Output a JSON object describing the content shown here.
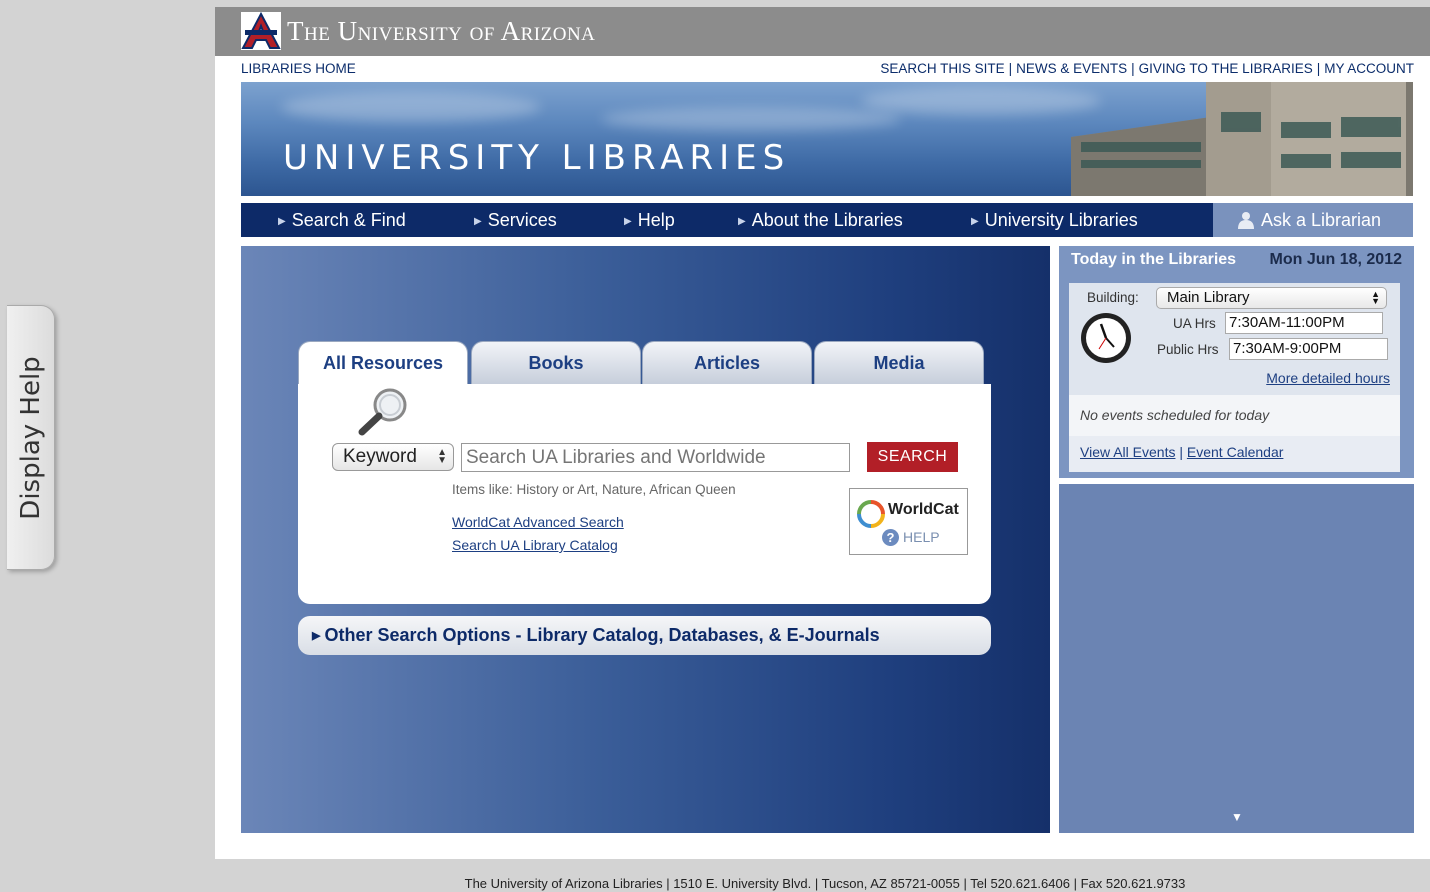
{
  "help_tab": {
    "label": "Display Help"
  },
  "header": {
    "university_name": "The University of Arizona",
    "libraries_home": "LIBRARIES HOME",
    "util_links": [
      "SEARCH THIS SITE",
      "NEWS & EVENTS",
      "GIVING TO THE LIBRARIES",
      "MY ACCOUNT"
    ],
    "banner_title": "UNIVERSITY LIBRARIES"
  },
  "nav": {
    "items": [
      "Search & Find",
      "Services",
      "Help",
      "About the Libraries",
      "University Libraries"
    ],
    "ask_label": "Ask a Librarian"
  },
  "search": {
    "tabs": [
      "All Resources",
      "Books",
      "Articles",
      "Media"
    ],
    "active_tab": "All Resources",
    "type_select": "Keyword",
    "input_placeholder": "Search UA Libraries and Worldwide",
    "button_label": "SEARCH",
    "hint": "Items like: History or Art, Nature, African Queen",
    "links": [
      "WorldCat Advanced Search",
      "Search UA Library Catalog"
    ],
    "worldcat_name": "WorldCat",
    "worldcat_help": "HELP",
    "other_options": "Other Search Options - Library Catalog, Databases, & E-Journals"
  },
  "today": {
    "title": "Today in the Libraries",
    "date": "Mon Jun 18, 2012",
    "building_label": "Building:",
    "building_value": "Main Library",
    "ua_hrs_label": "UA Hrs",
    "ua_hrs_value": "7:30AM-11:00PM",
    "public_hrs_label": "Public Hrs",
    "public_hrs_value": "7:30AM-9:00PM",
    "more_hours": "More detailed hours",
    "no_events": "No events scheduled for today",
    "view_all": "View All Events",
    "calendar": "Event Calendar"
  },
  "footer": {
    "text": "The University of Arizona Libraries | 1510 E. University Blvd. | Tucson, AZ 85721-0055 | Tel 520.621.6406 | Fax 520.621.9733"
  },
  "colors": {
    "nav_bg": "#0d2a68",
    "search_button": "#b21f27",
    "ua_bar": "#8c8c8c",
    "sidebar_blue": "#7c95c1"
  }
}
